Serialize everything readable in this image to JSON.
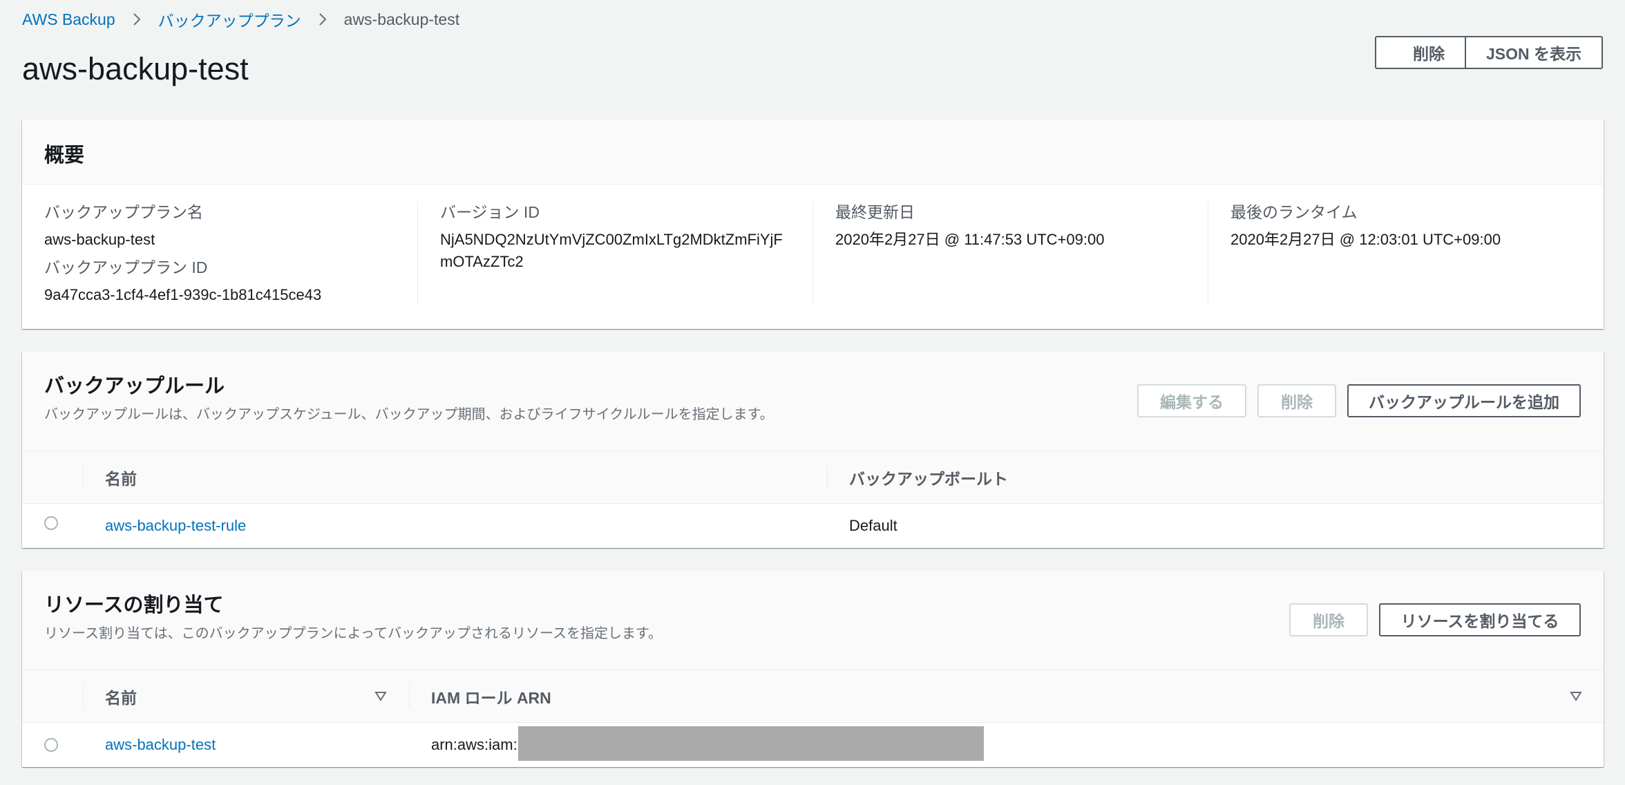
{
  "breadcrumb": {
    "items": [
      "AWS Backup",
      "バックアッププラン"
    ],
    "current": "aws-backup-test"
  },
  "page": {
    "title": "aws-backup-test",
    "delete_label": "削除",
    "json_label": "JSON を表示"
  },
  "summary": {
    "title": "概要",
    "plan_name_label": "バックアッププラン名",
    "plan_name": "aws-backup-test",
    "plan_id_label": "バックアッププラン ID",
    "plan_id": "9a47cca3-1cf4-4ef1-939c-1b81c415ce43",
    "version_label": "バージョン ID",
    "version_id": "NjA5NDQ2NzUtYmVjZC00ZmIxLTg2MDktZmFiYjFmOTAzZTc2",
    "updated_label": "最終更新日",
    "updated": "2020年2月27日 @ 11:47:53 UTC+09:00",
    "last_run_label": "最後のランタイム",
    "last_run": "2020年2月27日 @ 12:03:01 UTC+09:00"
  },
  "rules": {
    "title": "バックアップルール",
    "description": "バックアップルールは、バックアップスケジュール、バックアップ期間、およびライフサイクルルールを指定します。",
    "edit_label": "編集する",
    "delete_label": "削除",
    "add_label": "バックアップルールを追加",
    "columns": [
      "名前",
      "バックアップボールト"
    ],
    "rows": [
      {
        "name": "aws-backup-test-rule",
        "vault": "Default"
      }
    ]
  },
  "resources": {
    "title": "リソースの割り当て",
    "description": "リソース割り当ては、このバックアッププランによってバックアップされるリソースを指定します。",
    "delete_label": "削除",
    "assign_label": "リソースを割り当てる",
    "columns": [
      "名前",
      "IAM ロール ARN"
    ],
    "rows": [
      {
        "name": "aws-backup-test",
        "arn_prefix": "arn:aws:iam:"
      }
    ]
  }
}
